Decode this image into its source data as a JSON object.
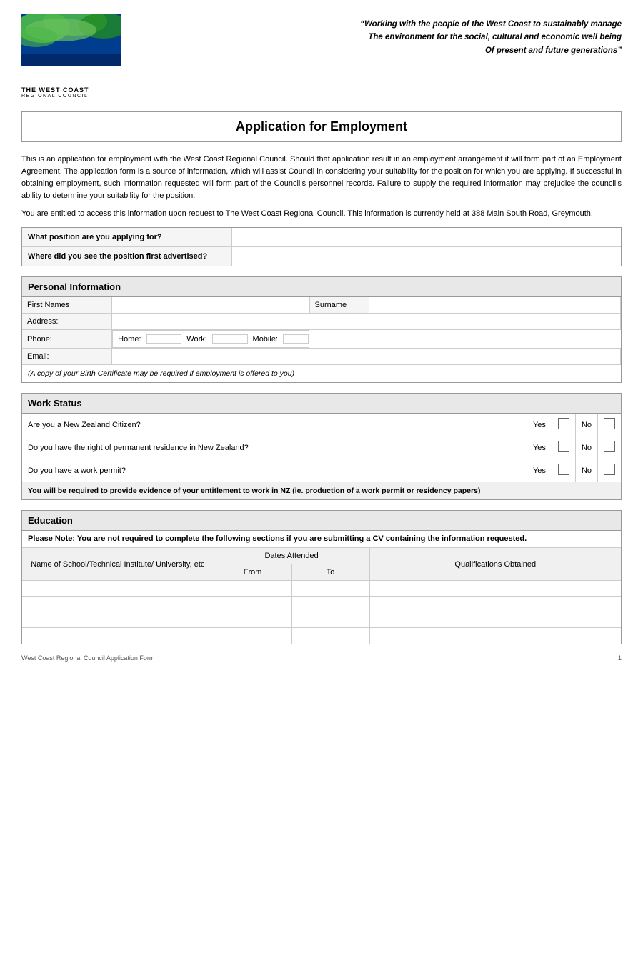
{
  "header": {
    "tagline_line1": "“Working with the people of the West Coast to sustainably manage",
    "tagline_line2": "The environment for the social, cultural and economic well being",
    "tagline_line3": "Of present and future generations”",
    "logo_title": "THE WEST COAST",
    "logo_subtitle": "REGIONAL COUNCIL"
  },
  "title": "Application for Employment",
  "intro": {
    "para1": "This is an application for employment with the West Coast Regional Council.  Should that application result in an employment arrangement it will form part of an Employment Agreement.  The application form is a source of information, which will assist Council in considering your suitability for the position for which you are applying.  If successful in obtaining employment, such information requested will form part of the Council’s personnel records.  Failure to supply the required information may prejudice the council’s ability to determine your suitability for the position.",
    "para2": "You are entitled to access this information upon request to The West Coast Regional Council.  This information is currently held at 388 Main South Road, Greymouth."
  },
  "position_section": {
    "row1_label": "What position are you applying for?",
    "row2_label": "Where did you see the position first advertised?"
  },
  "personal_section": {
    "title": "Personal Information",
    "first_names_label": "First Names",
    "surname_label": "Surname",
    "address_label": "Address:",
    "phone_label": "Phone:",
    "home_label": "Home:",
    "work_label": "Work:",
    "mobile_label": "Mobile:",
    "email_label": "Email:",
    "birth_note": "(A copy of your Birth Certificate may be required if employment is offered to you)"
  },
  "work_status_section": {
    "title": "Work Status",
    "q1": "Are you a New Zealand Citizen?",
    "q2": "Do you have the right of permanent residence in New Zealand?",
    "q3": "Do you have a work permit?",
    "yes_label": "Yes",
    "no_label": "No",
    "note": "You will be required to provide evidence of your entitlement to work in NZ (ie. production of a work permit or residency papers)"
  },
  "education_section": {
    "title": "Education",
    "note": "Please Note: You are not required to complete the following sections if you are submitting a CV containing the information requested.",
    "col_school": "Name of School/Technical Institute/ University, etc",
    "col_dates": "Dates Attended",
    "col_from": "From",
    "col_to": "To",
    "col_qual": "Qualifications Obtained",
    "rows": [
      {
        "school": "",
        "from": "",
        "to": "",
        "qual": ""
      },
      {
        "school": "",
        "from": "",
        "to": "",
        "qual": ""
      },
      {
        "school": "",
        "from": "",
        "to": "",
        "qual": ""
      },
      {
        "school": "",
        "from": "",
        "to": "",
        "qual": ""
      }
    ]
  },
  "footer": {
    "left": "West Coast Regional Council Application Form",
    "right": "1"
  }
}
